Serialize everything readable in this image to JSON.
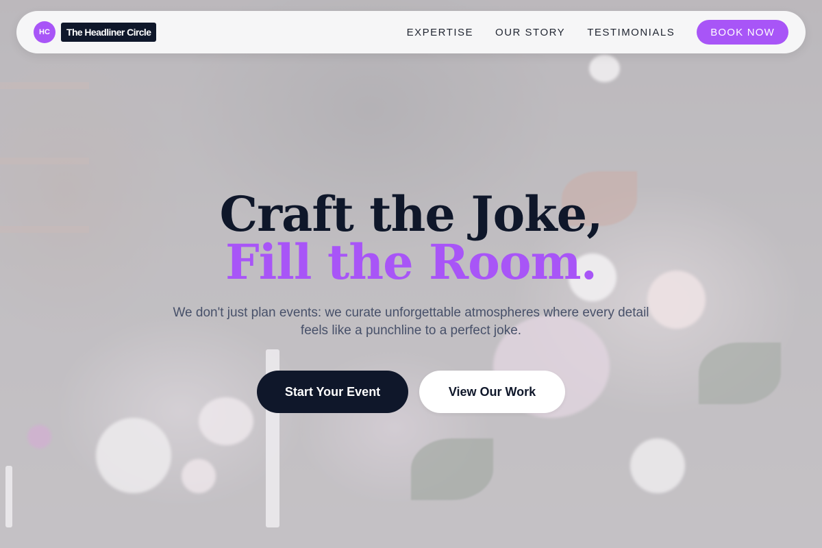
{
  "brand": {
    "badge": "HC",
    "name": "The Headliner Circle"
  },
  "nav": {
    "links": [
      "EXPERTISE",
      "OUR STORY",
      "TESTIMONIALS"
    ],
    "cta": "BOOK NOW"
  },
  "hero": {
    "line1": "Craft the Joke,",
    "line2": "Fill the Room.",
    "subtitle": "We don't just plan events: we curate unforgettable atmospheres where every detail feels like a punchline to a perfect joke.",
    "primary_cta": "Start Your Event",
    "secondary_cta": "View Our Work"
  },
  "colors": {
    "accent": "#a855f7",
    "dark": "#0f172a"
  }
}
